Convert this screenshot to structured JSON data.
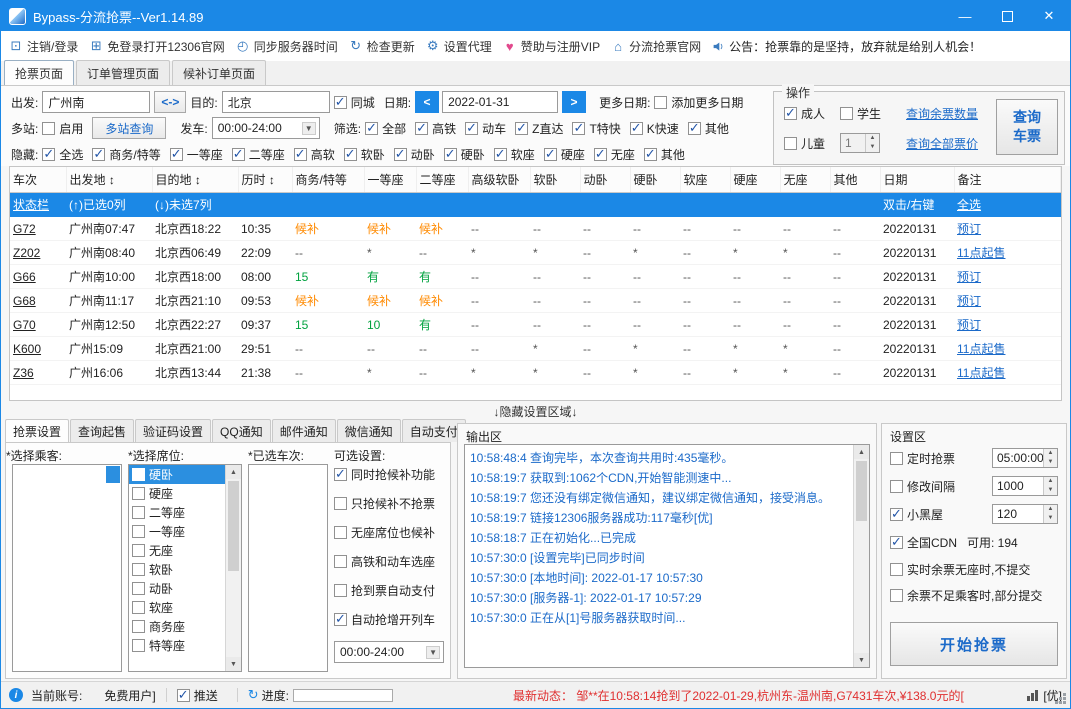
{
  "colors": {
    "accent": "#1b88e6",
    "link": "#1b6ac9",
    "waitlist": "#ff8a00",
    "available": "#00a23f",
    "alert": "#e03030"
  },
  "icons": {
    "up": "▲",
    "down": "▼",
    "left": "<",
    "right": ">",
    "swap": "<->",
    "minimize": "—",
    "close": "✕",
    "check": "✓"
  },
  "titlebar": {
    "title": "Bypass-分流抢票--Ver1.14.89"
  },
  "menubar": {
    "items": [
      {
        "icon_name": "computer-icon",
        "glyph": "⊡",
        "label": "注销/登录"
      },
      {
        "icon_name": "window-icon",
        "glyph": "⊞",
        "label": "免登录打开12306官网"
      },
      {
        "icon_name": "clock-icon",
        "glyph": "◴",
        "label": "同步服务器时间"
      },
      {
        "icon_name": "refresh-icon",
        "glyph": "↻",
        "label": "检查更新"
      },
      {
        "icon_name": "gear-icon",
        "glyph": "⚙",
        "label": "设置代理"
      },
      {
        "icon_name": "heart-icon",
        "glyph": "♥",
        "label": "赞助与注册VIP"
      },
      {
        "icon_name": "home-icon",
        "glyph": "⌂",
        "label": "分流抢票官网"
      }
    ],
    "announcement": "公告：抢票靠的是坚持，放弃就是给别人机会！"
  },
  "page_tabs": [
    {
      "label": "抢票页面",
      "active": true
    },
    {
      "label": "订单管理页面",
      "active": false
    },
    {
      "label": "候补订单页面",
      "active": false
    }
  ],
  "query": {
    "depart_label": "出发:",
    "depart_value": "广州南",
    "dest_label": "目的:",
    "dest_value": "北京",
    "same_city_label": "同城",
    "same_city_checked": true,
    "date_label": "日期:",
    "date_value": "2022-01-31",
    "more_dates_label": "更多日期:",
    "add_more_dates_label": "添加更多日期",
    "add_more_dates_checked": false,
    "multi_label": "多站:",
    "enable_label": "启用",
    "enable_checked": false,
    "multi_query_btn": "多站查询",
    "depart_time_label": "发车:",
    "depart_time_value": "00:00-24:00",
    "filter_label": "筛选:",
    "filters": [
      {
        "label": "全部",
        "checked": true
      },
      {
        "label": "高铁",
        "checked": true
      },
      {
        "label": "动车",
        "checked": true
      },
      {
        "label": "Z直达",
        "checked": true
      },
      {
        "label": "T特快",
        "checked": true
      },
      {
        "label": "K快速",
        "checked": true
      },
      {
        "label": "其他",
        "checked": true
      }
    ],
    "hide_label": "隐藏:",
    "hide_options": [
      {
        "label": "全选",
        "checked": true
      },
      {
        "label": "商务/特等",
        "checked": true
      },
      {
        "label": "一等座",
        "checked": true
      },
      {
        "label": "二等座",
        "checked": true
      },
      {
        "label": "高软",
        "checked": true
      },
      {
        "label": "软卧",
        "checked": true
      },
      {
        "label": "动卧",
        "checked": true
      },
      {
        "label": "硬卧",
        "checked": true
      },
      {
        "label": "软座",
        "checked": true
      },
      {
        "label": "硬座",
        "checked": true
      },
      {
        "label": "无座",
        "checked": true
      },
      {
        "label": "其他",
        "checked": true
      }
    ],
    "ops": {
      "title": "操作",
      "adult_label": "成人",
      "adult_checked": true,
      "student_label": "学生",
      "student_checked": false,
      "child_label": "儿童",
      "child_checked": false,
      "child_count": "1",
      "link_remaining": "查询余票数量",
      "link_price": "查询全部票价",
      "query_button": "查询车票"
    }
  },
  "table": {
    "columns": [
      "车次",
      "出发地 ↕",
      "目的地 ↕",
      "历时 ↕",
      "商务/特等",
      "一等座",
      "二等座",
      "高级软卧",
      "软卧",
      "动卧",
      "硬卧",
      "软座",
      "硬座",
      "无座",
      "其他",
      "日期",
      "备注"
    ],
    "status_row": [
      "状态栏",
      "(↑)已选0列",
      "(↓)未选7列",
      "",
      "",
      "",
      "",
      "",
      "",
      "",
      "",
      "",
      "",
      "",
      "",
      "双击/右键",
      "全选"
    ],
    "rows": [
      [
        "G72",
        "广州南07:47",
        "北京西18:22",
        "10:35",
        "候补",
        "候补",
        "候补",
        "--",
        "--",
        "--",
        "--",
        "--",
        "--",
        "--",
        "--",
        "20220131",
        "预订"
      ],
      [
        "Z202",
        "广州南08:40",
        "北京西06:49",
        "22:09",
        "--",
        "*",
        "--",
        "*",
        "*",
        "--",
        "*",
        "--",
        "*",
        "*",
        "--",
        "20220131",
        "11点起售"
      ],
      [
        "G66",
        "广州南10:00",
        "北京西18:00",
        "08:00",
        "15",
        "有",
        "有",
        "--",
        "--",
        "--",
        "--",
        "--",
        "--",
        "--",
        "--",
        "20220131",
        "预订"
      ],
      [
        "G68",
        "广州南11:17",
        "北京西21:10",
        "09:53",
        "候补",
        "候补",
        "候补",
        "--",
        "--",
        "--",
        "--",
        "--",
        "--",
        "--",
        "--",
        "20220131",
        "预订"
      ],
      [
        "G70",
        "广州南12:50",
        "北京西22:27",
        "09:37",
        "15",
        "10",
        "有",
        "--",
        "--",
        "--",
        "--",
        "--",
        "--",
        "--",
        "--",
        "20220131",
        "预订"
      ],
      [
        "K600",
        "广州15:09",
        "北京西21:00",
        "29:51",
        "--",
        "--",
        "--",
        "--",
        "*",
        "--",
        "*",
        "--",
        "*",
        "*",
        "--",
        "20220131",
        "11点起售"
      ],
      [
        "Z36",
        "广州16:06",
        "北京西13:44",
        "21:38",
        "--",
        "*",
        "--",
        "*",
        "*",
        "--",
        "*",
        "--",
        "*",
        "*",
        "--",
        "20220131",
        "11点起售"
      ]
    ]
  },
  "divider_label": "↓隐藏设置区域↓",
  "settings_tabs": [
    {
      "label": "抢票设置",
      "active": true
    },
    {
      "label": "查询起售",
      "active": false
    },
    {
      "label": "验证码设置",
      "active": false
    },
    {
      "label": "QQ通知",
      "active": false
    },
    {
      "label": "邮件通知",
      "active": false
    },
    {
      "label": "微信通知",
      "active": false
    },
    {
      "label": "自动支付",
      "active": false
    }
  ],
  "grab": {
    "passenger_label": "*选择乘客:",
    "seat_label": "*选择席位:",
    "seats": [
      {
        "label": "硬卧",
        "selected": true,
        "checked": false
      },
      {
        "label": "硬座",
        "selected": false,
        "checked": false
      },
      {
        "label": "二等座",
        "selected": false,
        "checked": false
      },
      {
        "label": "一等座",
        "selected": false,
        "checked": false
      },
      {
        "label": "无座",
        "selected": false,
        "checked": false
      },
      {
        "label": "软卧",
        "selected": false,
        "checked": false
      },
      {
        "label": "动卧",
        "selected": false,
        "checked": false
      },
      {
        "label": "软座",
        "selected": false,
        "checked": false
      },
      {
        "label": "商务座",
        "selected": false,
        "checked": false
      },
      {
        "label": "特等座",
        "selected": false,
        "checked": false
      }
    ],
    "train_label": "*已选车次:",
    "options_label": "可选设置:",
    "options": [
      {
        "label": "同时抢候补功能",
        "checked": true
      },
      {
        "label": "只抢候补不抢票",
        "checked": false
      },
      {
        "label": "无座席位也候补",
        "checked": false
      },
      {
        "label": "高铁和动车选座",
        "checked": false
      },
      {
        "label": "抢到票自动支付",
        "checked": false
      },
      {
        "label": "自动抢增开列车",
        "checked": true
      }
    ],
    "time_range": "00:00-24:00"
  },
  "output": {
    "title": "输出区",
    "lines": [
      "10:58:48:4  查询完毕，本次查询共用时:435毫秒。",
      "10:58:19:7  获取到:1062个CDN,开始智能测速中...",
      "10:58:19:7  您还没有绑定微信通知，建议绑定微信通知，接受消息。",
      "10:58:19:7  链接12306服务器成功:117毫秒[优]",
      "10:58:18:7  正在初始化...已完成",
      "10:57:30:0  [设置完毕]已同步时间",
      "10:57:30:0  [本地时间]: 2022-01-17 10:57:30",
      "10:57:30:0  [服务器-1]:  2022-01-17 10:57:29",
      "10:57:30:0  正在从[1]号服务器获取时间..."
    ]
  },
  "settings_area": {
    "title": "设置区",
    "timed": {
      "label": "定时抢票",
      "checked": false,
      "value": "05:00:00"
    },
    "interval": {
      "label": "修改间隔",
      "checked": false,
      "value": "1000"
    },
    "blackroom": {
      "label": "小黑屋",
      "checked": true,
      "value": "120"
    },
    "cdn": {
      "label": "全国CDN",
      "checked": true,
      "value": "可用: 194"
    },
    "noseat": {
      "label": "实时余票无座时,不提交",
      "checked": false
    },
    "partial": {
      "label": "余票不足乘客时,部分提交",
      "checked": false
    },
    "start_button": "开始抢票"
  },
  "statusbar": {
    "account_label": "当前账号:",
    "account_value": "免费用户]",
    "push_label": "推送",
    "push_checked": true,
    "progress_label": "进度:",
    "news": "最新动态： 邹**在10:58:14抢到了2022-01-29,杭州东-温州南,G7431车次,¥138.0元的[",
    "quality": "[优]"
  }
}
